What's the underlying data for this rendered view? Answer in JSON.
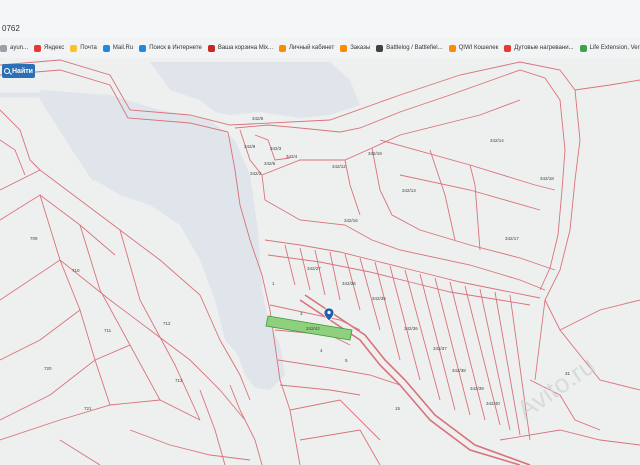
{
  "browser": {
    "url_fragment": "0762"
  },
  "bookmarks": [
    {
      "label": "ayun...",
      "icon": "page-icon",
      "color": "#9aa0a6"
    },
    {
      "label": "Яндекс",
      "icon": "yandex-icon",
      "color": "#e53935"
    },
    {
      "label": "Почта",
      "icon": "mail-icon",
      "color": "#fbc02d"
    },
    {
      "label": "Mail.Ru",
      "icon": "mailru-icon",
      "color": "#1e88e5"
    },
    {
      "label": "Поиск в Интернете",
      "icon": "search-icon",
      "color": "#1e88e5"
    },
    {
      "label": "Ваша корзина Mix...",
      "icon": "cart-icon",
      "color": "#c62828"
    },
    {
      "label": "Личный кабинет",
      "icon": "account-icon",
      "color": "#fb8c00"
    },
    {
      "label": "Заказы",
      "icon": "orders-icon",
      "color": "#fb8c00"
    },
    {
      "label": "Battlelog / Battlefiel...",
      "icon": "battlelog-icon",
      "color": "#424242"
    },
    {
      "label": "QIWI Кошелек",
      "icon": "qiwi-icon",
      "color": "#fb8c00"
    },
    {
      "label": "Дутовые нагревани...",
      "icon": "youtube-icon",
      "color": "#e53935"
    },
    {
      "label": "Life Extension, Vers...",
      "icon": "leaf-icon",
      "color": "#43a047"
    }
  ],
  "toolbar": {
    "find_label": "Найти"
  },
  "map": {
    "plot_labels": [
      "342/14",
      "342/13",
      "342/12",
      "342/16",
      "342/17",
      "342/9",
      "342/18",
      "342/19",
      "342/27",
      "342/26",
      "342/35",
      "342/36",
      "342/37",
      "342/38",
      "342/39",
      "342/40",
      "342/2",
      "342/3",
      "342/4",
      "342/5",
      "342/6",
      "709",
      "710",
      "711",
      "712",
      "713",
      "720",
      "721",
      "1",
      "3",
      "4",
      "5",
      "15",
      "31"
    ],
    "highlighted_plot": "342/42",
    "marker_icon": "location-pin-icon",
    "watermark": "Avito.ru"
  }
}
